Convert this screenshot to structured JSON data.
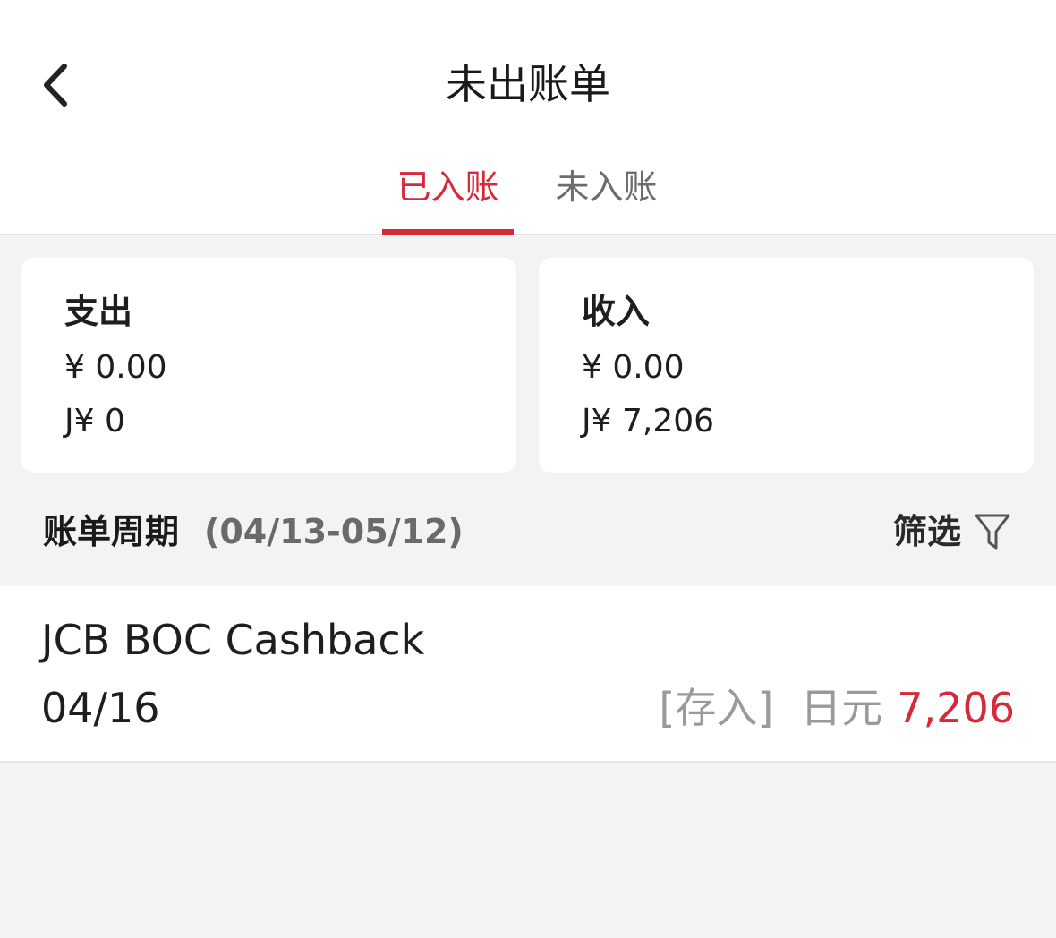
{
  "header": {
    "back_icon": "chevron-left-icon",
    "title": "未出账单"
  },
  "tabs": [
    {
      "label": "已入账",
      "active": true
    },
    {
      "label": "未入账",
      "active": false
    }
  ],
  "summary": {
    "expense": {
      "label": "支出",
      "cny": "¥ 0.00",
      "jpy": "J¥ 0"
    },
    "income": {
      "label": "收入",
      "cny": "¥ 0.00",
      "jpy": "J¥ 7,206"
    }
  },
  "period": {
    "label": "账单周期",
    "range": "(04/13-05/12)",
    "filter_label": "筛选",
    "filter_icon": "filter-funnel-icon"
  },
  "transactions": [
    {
      "merchant": "JCB BOC Cashback",
      "date": "04/16",
      "tag": "[存入]",
      "currency": "日元",
      "amount": "7,206"
    }
  ],
  "colors": {
    "accent": "#d6293a",
    "background": "#f3f3f4",
    "card": "#ffffff",
    "muted_text": "#9a9a9a"
  }
}
